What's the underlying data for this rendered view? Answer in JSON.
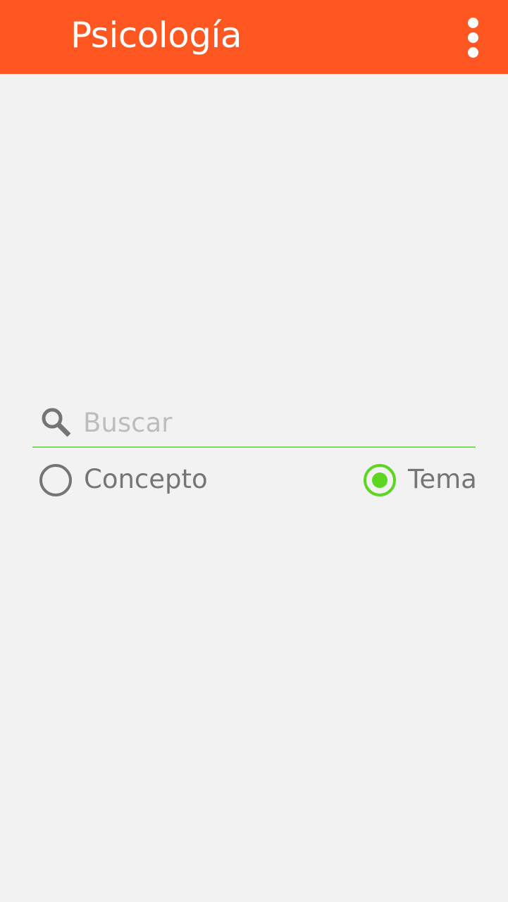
{
  "app_bar": {
    "title": "Psicología",
    "background_color": "#ff5722",
    "menu_icon": "more-vertical-icon"
  },
  "search": {
    "placeholder": "Buscar",
    "value": "",
    "icon": "search-icon",
    "underline_color": "#7ed957"
  },
  "search_mode": {
    "options": [
      {
        "label": "Concepto",
        "selected": false
      },
      {
        "label": "Tema",
        "selected": true
      }
    ],
    "selected_color": "#5cd61e",
    "unselected_color": "#757575"
  }
}
